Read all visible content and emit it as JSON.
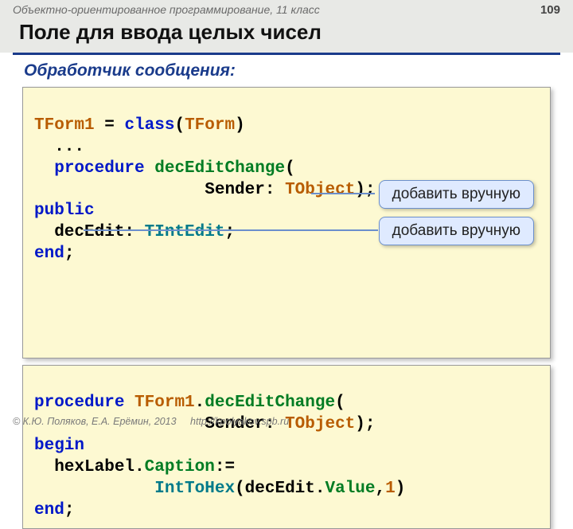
{
  "header": {
    "course": "Объектно-ориентированное программирование, 11 класс",
    "page_number": "109"
  },
  "title": "Поле для ввода целых чисел",
  "subtitle": "Обработчик сообщения:",
  "callouts": {
    "c1": "добавить вручную",
    "c2": "добавить вручную"
  },
  "code1": {
    "L1a": "TForm1",
    "L1b": " = ",
    "L1c": "class",
    "L1d": "(",
    "L1e": "TForm",
    "L1f": ")",
    "L2": "  ... ",
    "L3a": "  ",
    "L3b": "procedure",
    "L3c": " ",
    "L3d": "decEditChange",
    "L3e": "(",
    "L4a": "                 Sender: ",
    "L4b": "TObject",
    "L4c": ");",
    "L5": "public",
    "L6a": "  decEdit: ",
    "L6b": "TIntEdit",
    "L6c": ";",
    "L7a": "end",
    "L7b": ";"
  },
  "code2": {
    "L1a": "procedure",
    "L1b": " ",
    "L1c": "TForm1",
    "L1d": ".",
    "L1e": "decEditChange",
    "L1f": "(",
    "L2a": "                 Sender: ",
    "L2b": "TObject",
    "L2c": ");",
    "L3": "begin",
    "L4a": "  hexLabel.",
    "L4b": "Caption",
    "L4c": ":= ",
    "L5a": "            ",
    "L5b": "IntToHex",
    "L5c": "(decEdit.",
    "L5d": "Value",
    "L5e": ",",
    "L5f": "1",
    "L5g": ")",
    "L6a": "end",
    "L6b": ";"
  },
  "footer": {
    "copyright": "© К.Ю. Поляков, Е.А. Ерёмин, 2013",
    "url": "http://kpolyakov.spb.ru"
  }
}
